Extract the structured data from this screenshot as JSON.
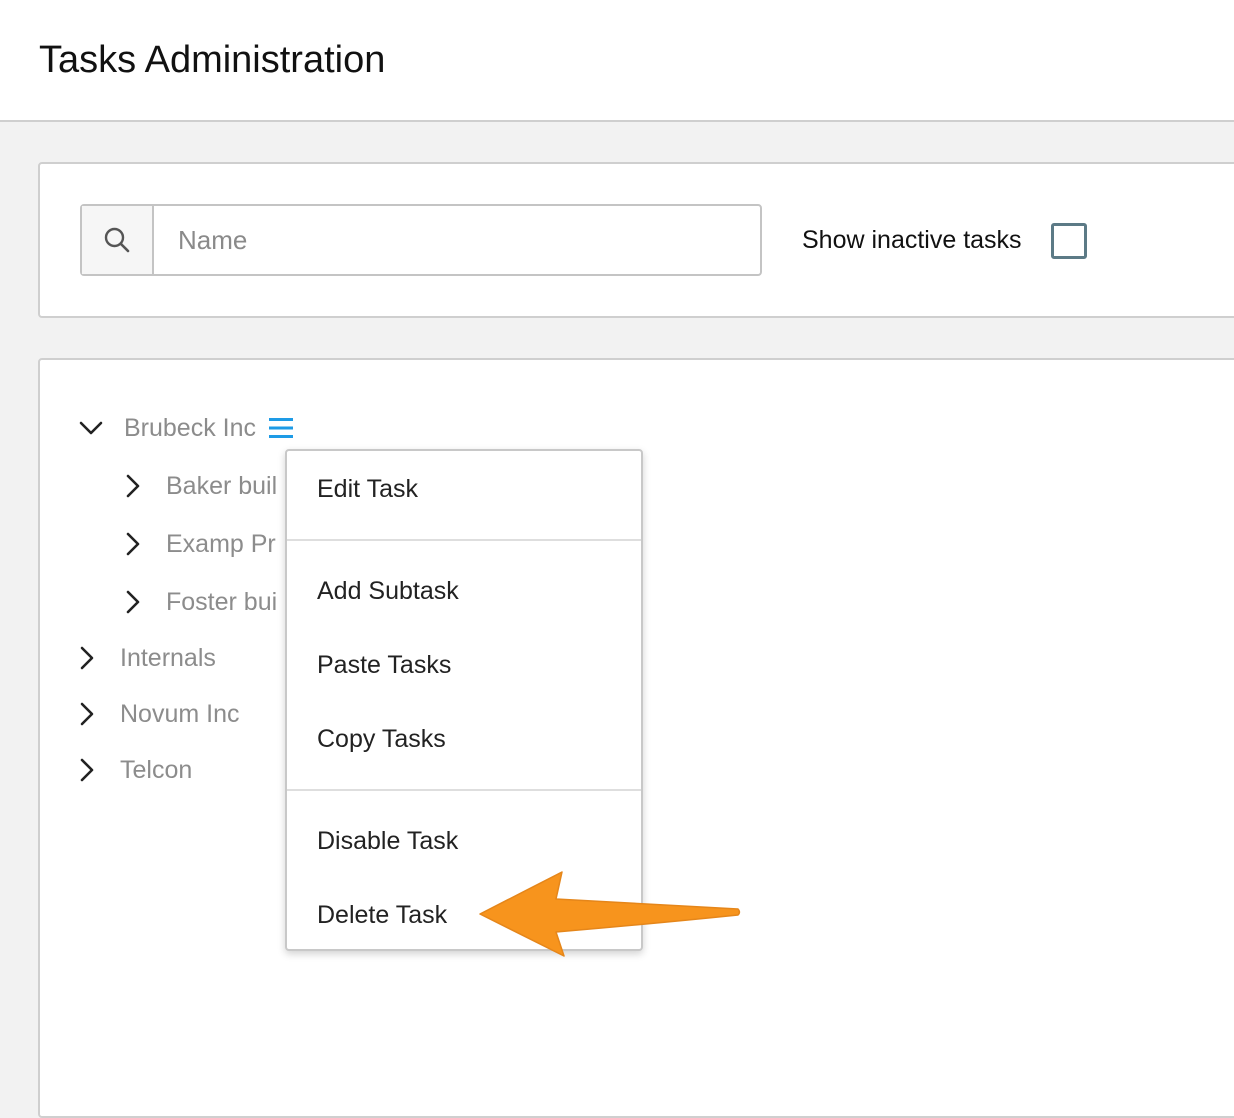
{
  "header": {
    "title": "Tasks Administration"
  },
  "filters": {
    "search_placeholder": "Name",
    "show_inactive_label": "Show inactive tasks",
    "show_inactive_checked": false
  },
  "tree": {
    "nodes": [
      {
        "label": "Brubeck Inc",
        "expanded": true,
        "level": 0
      },
      {
        "label": "Baker buil",
        "expanded": false,
        "level": 1
      },
      {
        "label": "Examp Pr",
        "expanded": false,
        "level": 1
      },
      {
        "label": "Foster bui",
        "expanded": false,
        "level": 1
      },
      {
        "label": "Internals",
        "expanded": false,
        "level": 0
      },
      {
        "label": "Novum Inc",
        "expanded": false,
        "level": 0
      },
      {
        "label": "Telcon",
        "expanded": false,
        "level": 0
      }
    ]
  },
  "context_menu": {
    "items": [
      {
        "label": "Edit Task"
      },
      {
        "label": "Add Subtask"
      },
      {
        "label": "Paste Tasks"
      },
      {
        "label": "Copy Tasks"
      },
      {
        "label": "Disable Task"
      },
      {
        "label": "Delete Task"
      }
    ]
  },
  "icons": {
    "search": "search-icon",
    "expanded": "chevron-down-icon",
    "collapsed": "chevron-right-icon",
    "menu": "hamburger-menu-icon",
    "annotation": "arrow-left-icon"
  },
  "colors": {
    "menu_icon": "#1e9be6",
    "annotation_arrow": "#f7941d",
    "checkbox_border": "#5c7a86",
    "tree_label": "#8c8c8c"
  }
}
